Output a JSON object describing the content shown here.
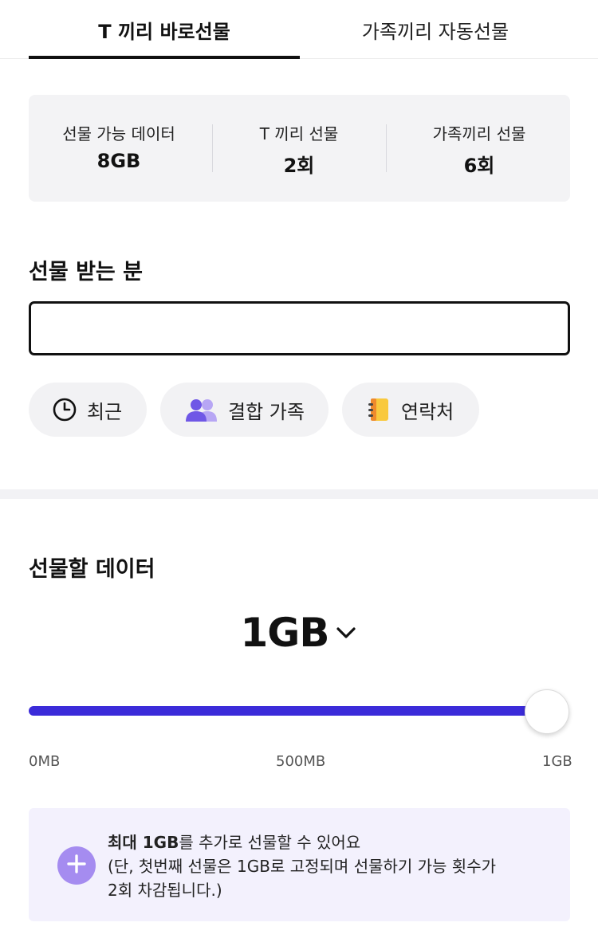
{
  "tabs": [
    {
      "label": "T 끼리 바로선물",
      "active": true
    },
    {
      "label": "가족끼리 자동선물",
      "active": false
    }
  ],
  "summary": [
    {
      "label": "선물 가능 데이터",
      "value": "8GB"
    },
    {
      "label": "T 끼리 선물",
      "value": "2회"
    },
    {
      "label": "가족끼리 선물",
      "value": "6회"
    }
  ],
  "recipient": {
    "title": "선물 받는 분",
    "input_value": "",
    "chips": [
      {
        "label": "최근",
        "icon": "clock-icon"
      },
      {
        "label": "결합 가족",
        "icon": "family-icon"
      },
      {
        "label": "연락처",
        "icon": "contacts-book-icon"
      }
    ]
  },
  "gift_data": {
    "title": "선물할 데이터",
    "amount": "1GB",
    "slider": {
      "min_label": "0MB",
      "mid_label": "500MB",
      "max_label": "1GB",
      "value_fraction": 1.0
    },
    "notice": {
      "bold": "최대 1GB",
      "line1_rest": "를 추가로 선물할 수 있어요",
      "line2": "(단, 첫번째 선물은 1GB로 고정되며 선물하기 가능 횟수가",
      "line3": "2회 차감됩니다.)"
    }
  },
  "colors": {
    "accent": "#3b2bd9",
    "plus_button": "#a58cf0",
    "notice_bg": "#f3f1fd",
    "card_bg": "#f3f3f5"
  }
}
